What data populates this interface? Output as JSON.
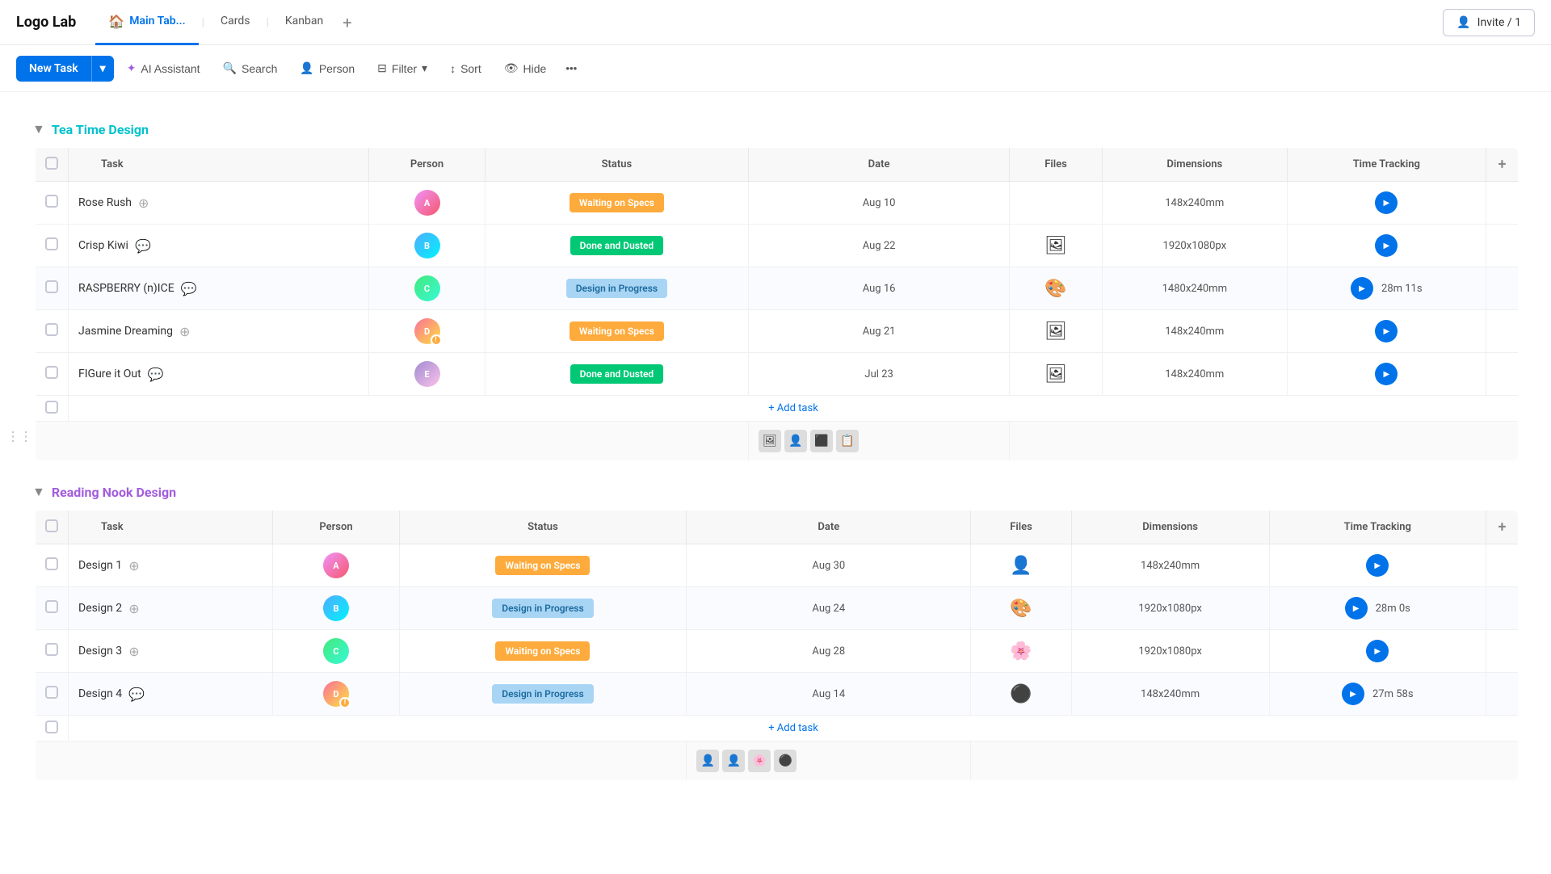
{
  "app": {
    "logo": "Logo Lab",
    "invite_label": "Invite / 1"
  },
  "tabs": [
    {
      "id": "main",
      "label": "Main Tab...",
      "icon": "🏠",
      "active": true
    },
    {
      "id": "cards",
      "label": "Cards",
      "active": false
    },
    {
      "id": "kanban",
      "label": "Kanban",
      "active": false
    }
  ],
  "toolbar": {
    "new_task": "New Task",
    "ai_assistant": "AI Assistant",
    "search": "Search",
    "person": "Person",
    "filter": "Filter",
    "sort": "Sort",
    "hide": "Hide"
  },
  "sections": [
    {
      "id": "tea-time",
      "title": "Tea Time Design",
      "color": "teal",
      "columns": [
        "Task",
        "Person",
        "Status",
        "Date",
        "Files",
        "Dimensions",
        "Time Tracking"
      ],
      "rows": [
        {
          "id": 1,
          "task": "Rose Rush",
          "status": "Waiting on Specs",
          "status_type": "waiting",
          "date": "Aug 10",
          "dimensions": "148x240mm",
          "time": "",
          "has_file": false
        },
        {
          "id": 2,
          "task": "Crisp Kiwi",
          "status": "Done and Dusted",
          "status_type": "done",
          "date": "Aug 22",
          "dimensions": "1920x1080px",
          "time": "",
          "has_file": true
        },
        {
          "id": 3,
          "task": "RASPBERRY (n)ICE",
          "status": "Design in Progress",
          "status_type": "design",
          "date": "Aug 16",
          "dimensions": "1480x240mm",
          "time": "28m 11s",
          "has_file": true
        },
        {
          "id": 4,
          "task": "Jasmine Dreaming",
          "status": "Waiting on Specs",
          "status_type": "waiting",
          "date": "Aug 21",
          "dimensions": "148x240mm",
          "time": "",
          "has_file": true
        },
        {
          "id": 5,
          "task": "FIGure it Out",
          "status": "Done and Dusted",
          "status_type": "done",
          "date": "Jul 23",
          "dimensions": "148x240mm",
          "time": "",
          "has_file": true
        }
      ],
      "add_task": "+ Add task"
    },
    {
      "id": "reading-nook",
      "title": "Reading Nook Design",
      "color": "purple",
      "columns": [
        "Task",
        "Person",
        "Status",
        "Date",
        "Files",
        "Dimensions",
        "Time Tracking"
      ],
      "rows": [
        {
          "id": 1,
          "task": "Design 1",
          "status": "Waiting on Specs",
          "status_type": "waiting",
          "date": "Aug 30",
          "dimensions": "148x240mm",
          "time": "",
          "has_file": true
        },
        {
          "id": 2,
          "task": "Design 2",
          "status": "Design in Progress",
          "status_type": "design",
          "date": "Aug 24",
          "dimensions": "1920x1080px",
          "time": "28m 0s",
          "has_file": true
        },
        {
          "id": 3,
          "task": "Design 3",
          "status": "Waiting on Specs",
          "status_type": "waiting",
          "date": "Aug 28",
          "dimensions": "1920x1080px",
          "time": "",
          "has_file": true
        },
        {
          "id": 4,
          "task": "Design 4",
          "status": "Design in Progress",
          "status_type": "design",
          "date": "Aug 14",
          "dimensions": "148x240mm",
          "time": "27m 58s",
          "has_file": true
        }
      ],
      "add_task": "+ Add task"
    }
  ]
}
